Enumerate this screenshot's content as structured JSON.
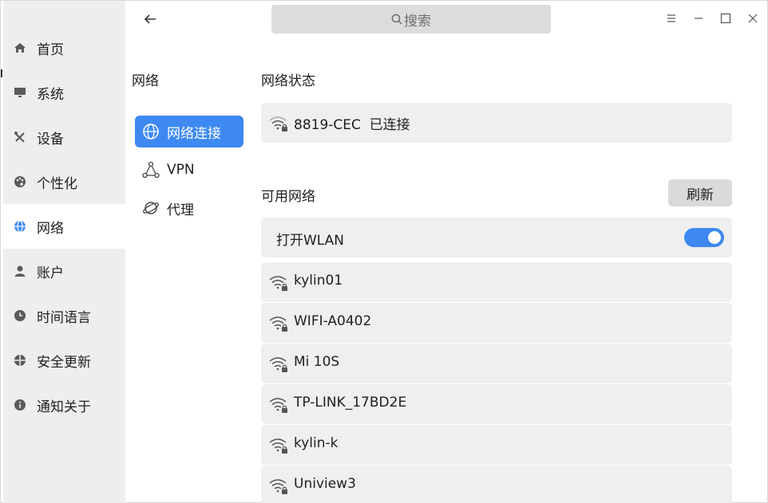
{
  "sidebar": {
    "items": [
      {
        "label": "首页",
        "icon": "home-icon"
      },
      {
        "label": "系统",
        "icon": "monitor-icon"
      },
      {
        "label": "设备",
        "icon": "tools-icon"
      },
      {
        "label": "个性化",
        "icon": "palette-icon"
      },
      {
        "label": "网络",
        "icon": "globe-icon",
        "active": true
      },
      {
        "label": "账户",
        "icon": "user-icon"
      },
      {
        "label": "时间语言",
        "icon": "clock-icon"
      },
      {
        "label": "安全更新",
        "icon": "shield-icon"
      },
      {
        "label": "通知关于",
        "icon": "info-icon"
      }
    ]
  },
  "search": {
    "placeholder": "搜索"
  },
  "network_panel": {
    "title": "网络",
    "items": [
      {
        "label": "网络连接",
        "icon": "globe-icon",
        "active": true
      },
      {
        "label": "VPN",
        "icon": "vpn-icon"
      },
      {
        "label": "代理",
        "icon": "planet-icon"
      }
    ]
  },
  "status": {
    "title": "网络状态",
    "connection": "8819-CEC  已连接"
  },
  "available": {
    "title": "可用网络",
    "refresh_label": "刷新",
    "wlan_label": "打开WLAN",
    "wlan_on": true,
    "networks": [
      "kylin01",
      "WIFI-A0402",
      "Mi 10S",
      "TP-LINK_17BD2E",
      "kylin-k",
      "Uniview3"
    ]
  },
  "colors": {
    "accent": "#3d89f1",
    "sidebar_bg": "#eeeeee",
    "card_bg": "#efefef"
  }
}
